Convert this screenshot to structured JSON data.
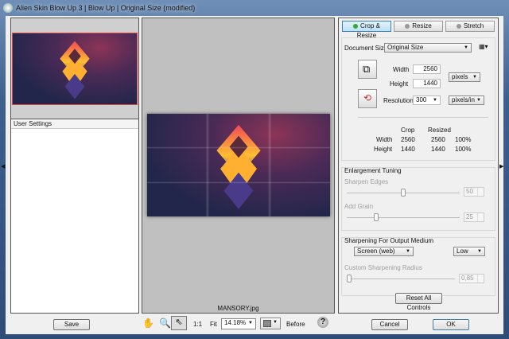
{
  "window": {
    "title": "Alien Skin Blow Up 3 | Blow Up | Original Size (modified)"
  },
  "left_panel": {
    "user_settings_label": "User Settings"
  },
  "preview": {
    "filename": "MANSORY.jpg"
  },
  "tabs": [
    {
      "label": "Crop & Resize",
      "active": true
    },
    {
      "label": "Resize",
      "active": false
    },
    {
      "label": "Stretch",
      "active": false
    }
  ],
  "document_size": {
    "label": "Document Size",
    "value": "Original Size"
  },
  "dimensions": {
    "width_label": "Width",
    "width": "2560",
    "height_label": "Height",
    "height": "1440",
    "unit": "pixels",
    "resolution_label": "Resolution",
    "resolution": "300",
    "resolution_unit": "pixels/in"
  },
  "summary": {
    "col_crop": "Crop",
    "col_resized": "Resized",
    "rows": [
      {
        "label": "Width",
        "crop": "2560",
        "resized": "2560",
        "pct": "100%"
      },
      {
        "label": "Height",
        "crop": "1440",
        "resized": "1440",
        "pct": "100%"
      }
    ]
  },
  "tuning": {
    "title": "Enlargement Tuning",
    "sharpen_label": "Sharpen Edges",
    "sharpen": "50",
    "sharpen_level": 50,
    "grain_label": "Add Grain",
    "grain": "25",
    "grain_level": 25
  },
  "sharpening": {
    "title": "Sharpening For Output Medium",
    "medium": "Screen (web)",
    "amount": "Low",
    "radius_label": "Custom Sharpening Radius",
    "radius": "0,85"
  },
  "reset_label": "Reset All Controls",
  "toolbar": {
    "save": "Save",
    "one_to_one": "1:1",
    "fit": "Fit",
    "zoom": "14.18%",
    "before": "Before",
    "help": "?",
    "cancel": "Cancel",
    "ok": "OK"
  },
  "colors": {
    "accent": "#3c7fb1",
    "selection": "#e04848"
  }
}
